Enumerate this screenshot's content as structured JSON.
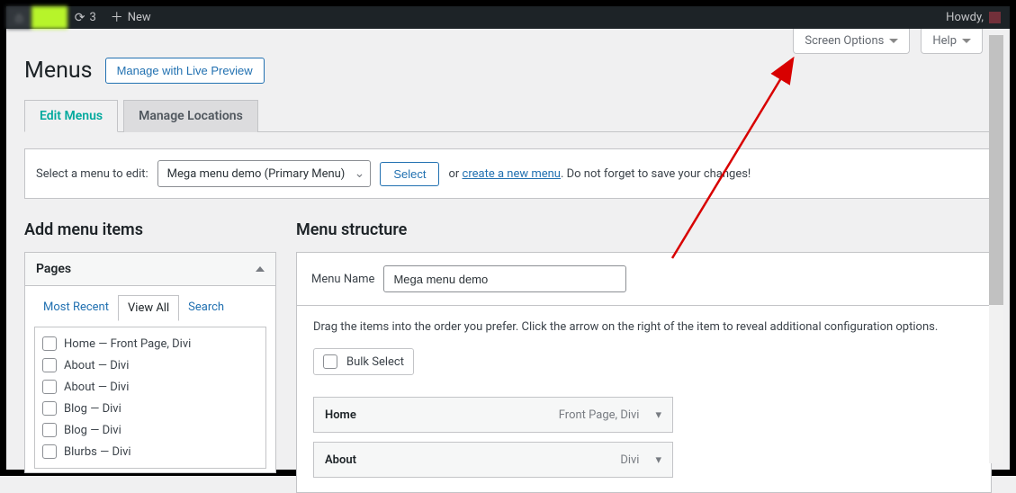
{
  "adminbar": {
    "refresh_count": "3",
    "new_label": "New",
    "howdy": "Howdy,"
  },
  "screen_meta": {
    "screen_options": "Screen Options",
    "help": "Help"
  },
  "page": {
    "title": "Menus",
    "live_preview": "Manage with Live Preview"
  },
  "tabs": {
    "edit": "Edit Menus",
    "locations": "Manage Locations"
  },
  "selector": {
    "label": "Select a menu to edit:",
    "current": "Mega menu demo (Primary Menu)",
    "select_btn": "Select",
    "or": "or",
    "create_link": "create a new menu",
    "reminder": ". Do not forget to save your changes!"
  },
  "left": {
    "heading": "Add menu items",
    "accordion_title": "Pages",
    "subtabs": {
      "recent": "Most Recent",
      "viewall": "View All",
      "search": "Search"
    },
    "items": [
      "Home — Front Page, Divi",
      "About — Divi",
      "About — Divi",
      "Blog — Divi",
      "Blog — Divi",
      "Blurbs — Divi"
    ]
  },
  "right": {
    "heading": "Menu structure",
    "menu_name_label": "Menu Name",
    "menu_name_value": "Mega menu demo",
    "instructions": "Drag the items into the order you prefer. Click the arrow on the right of the item to reveal additional configuration options.",
    "bulk_label": "Bulk Select",
    "menu_items": [
      {
        "title": "Home",
        "type": "Front Page, Divi"
      },
      {
        "title": "About",
        "type": "Divi"
      }
    ]
  }
}
